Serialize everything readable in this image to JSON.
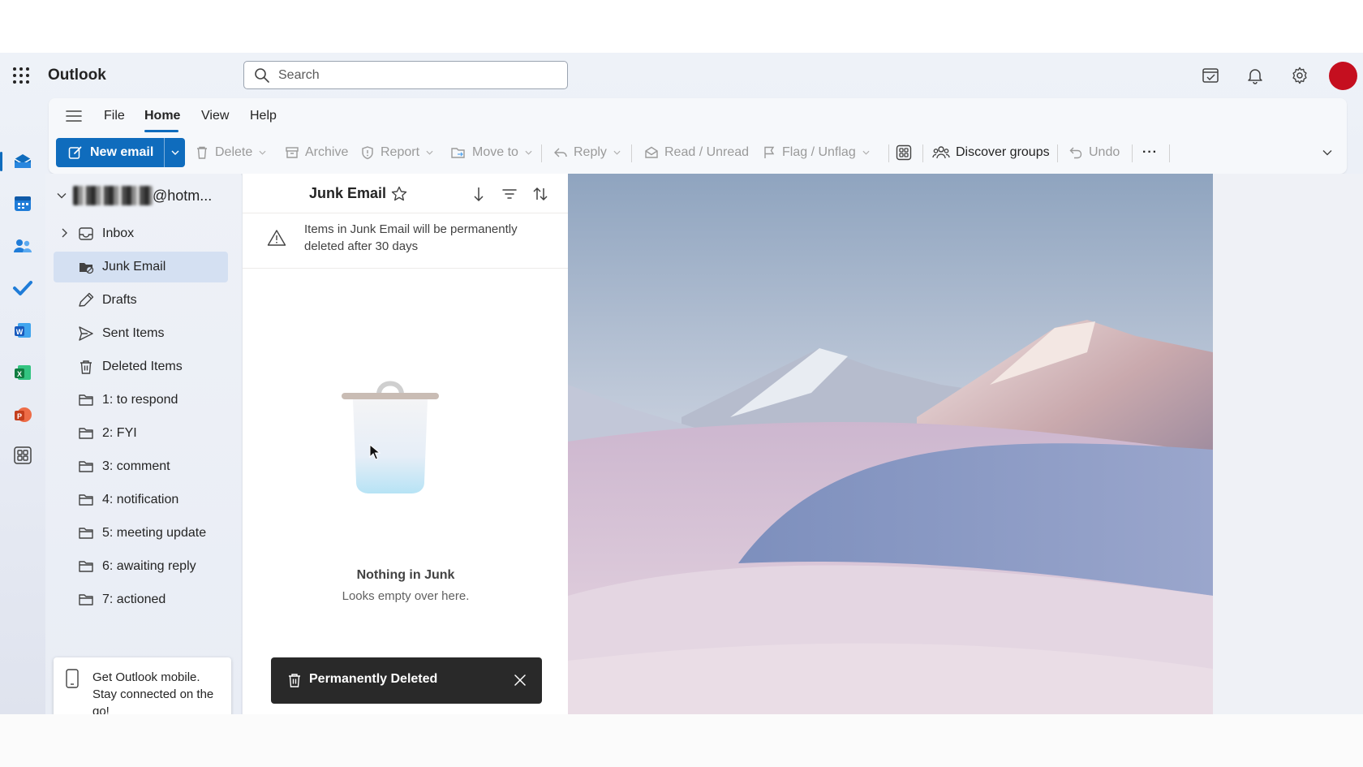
{
  "app": {
    "brand": "Outlook",
    "search_placeholder": "Search"
  },
  "ribbon": {
    "tabs": [
      "File",
      "Home",
      "View",
      "Help"
    ],
    "active_tab": "Home",
    "new_email": "New email",
    "commands": {
      "delete": "Delete",
      "archive": "Archive",
      "report": "Report",
      "move_to": "Move to",
      "reply": "Reply",
      "read_unread": "Read / Unread",
      "flag_unflag": "Flag / Unflag",
      "discover_groups": "Discover groups",
      "undo": "Undo",
      "more": "···"
    }
  },
  "folder_pane": {
    "account_suffix": "@hotm...",
    "folders": [
      {
        "label": "Inbox",
        "icon": "inbox-icon"
      },
      {
        "label": "Junk Email",
        "icon": "junk-icon",
        "selected": true
      },
      {
        "label": "Drafts",
        "icon": "drafts-icon"
      },
      {
        "label": "Sent Items",
        "icon": "send-icon"
      },
      {
        "label": "Deleted Items",
        "icon": "trash-icon"
      },
      {
        "label": "1: to respond",
        "icon": "folder-icon"
      },
      {
        "label": "2: FYI",
        "icon": "folder-icon"
      },
      {
        "label": "3: comment",
        "icon": "folder-icon"
      },
      {
        "label": "4: notification",
        "icon": "folder-icon"
      },
      {
        "label": "5: meeting update",
        "icon": "folder-icon"
      },
      {
        "label": "6: awaiting reply",
        "icon": "folder-icon"
      },
      {
        "label": "7: actioned",
        "icon": "folder-icon"
      }
    ],
    "mobile_promo": "Get Outlook mobile. Stay connected on the go!"
  },
  "message_list": {
    "title": "Junk Email",
    "warning": "Items in Junk Email will be permanently deleted after 30 days",
    "empty_title": "Nothing in Junk",
    "empty_subtitle": "Looks empty over here."
  },
  "toast": {
    "text": "Permanently Deleted"
  },
  "colors": {
    "accent": "#0f6cbd",
    "avatar": "#c50f1f",
    "toast_bg": "#292929"
  }
}
